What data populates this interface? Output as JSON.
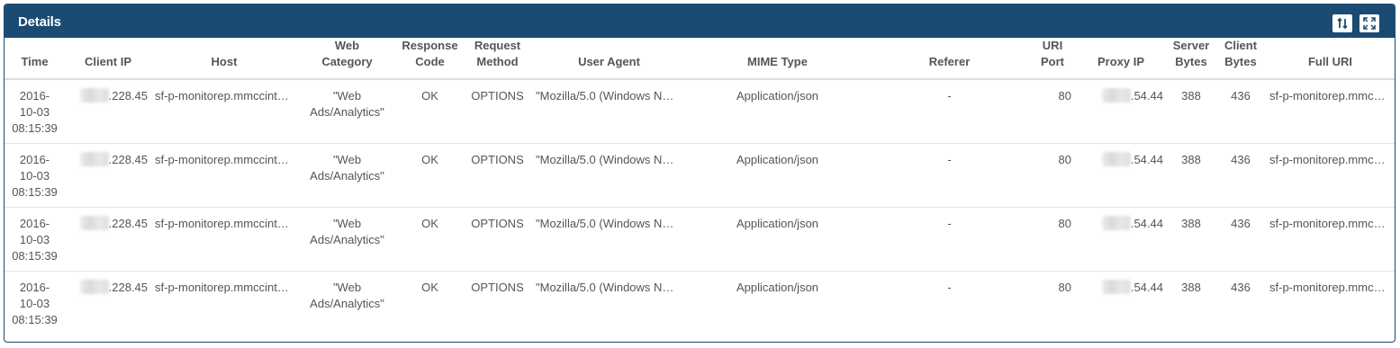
{
  "panel": {
    "title": "Details",
    "sort_icon": "sort-icon",
    "expand_icon": "expand-icon"
  },
  "columns": [
    [
      "Time"
    ],
    [
      "Client IP"
    ],
    [
      "Host"
    ],
    [
      "Web",
      "Category"
    ],
    [
      "Response",
      "Code"
    ],
    [
      "Request",
      "Method"
    ],
    [
      "User Agent"
    ],
    [
      "MIME Type"
    ],
    [
      "Referer"
    ],
    [
      "URI",
      "Port"
    ],
    [
      "Proxy IP"
    ],
    [
      "Server",
      "Bytes"
    ],
    [
      "Client",
      "Bytes"
    ],
    [
      "Full URI"
    ]
  ],
  "rows": [
    {
      "time": [
        "2016-",
        "10-03",
        "08:15:39"
      ],
      "client_ip": ".228.45",
      "host": "sf-p-monitorep.mmccint…",
      "web_category": [
        "\"Web",
        "Ads/Analytics\""
      ],
      "response_code": "OK",
      "request_method": "OPTIONS",
      "user_agent": "\"Mozilla/5.0 (Windows N…",
      "mime_type": "Application/json",
      "referer": "-",
      "uri_port": "80",
      "proxy_ip": ".54.44",
      "server_bytes": "388",
      "client_bytes": "436",
      "full_uri": "sf-p-monitorep.mmccint…"
    },
    {
      "time": [
        "2016-",
        "10-03",
        "08:15:39"
      ],
      "client_ip": ".228.45",
      "host": "sf-p-monitorep.mmccint…",
      "web_category": [
        "\"Web",
        "Ads/Analytics\""
      ],
      "response_code": "OK",
      "request_method": "OPTIONS",
      "user_agent": "\"Mozilla/5.0 (Windows N…",
      "mime_type": "Application/json",
      "referer": "-",
      "uri_port": "80",
      "proxy_ip": ".54.44",
      "server_bytes": "388",
      "client_bytes": "436",
      "full_uri": "sf-p-monitorep.mmccint…"
    },
    {
      "time": [
        "2016-",
        "10-03",
        "08:15:39"
      ],
      "client_ip": ".228.45",
      "host": "sf-p-monitorep.mmccint…",
      "web_category": [
        "\"Web",
        "Ads/Analytics\""
      ],
      "response_code": "OK",
      "request_method": "OPTIONS",
      "user_agent": "\"Mozilla/5.0 (Windows N…",
      "mime_type": "Application/json",
      "referer": "-",
      "uri_port": "80",
      "proxy_ip": ".54.44",
      "server_bytes": "388",
      "client_bytes": "436",
      "full_uri": "sf-p-monitorep.mmccint…"
    },
    {
      "time": [
        "2016-",
        "10-03",
        "08:15:39"
      ],
      "client_ip": ".228.45",
      "host": "sf-p-monitorep.mmccint…",
      "web_category": [
        "\"Web",
        "Ads/Analytics\""
      ],
      "response_code": "OK",
      "request_method": "OPTIONS",
      "user_agent": "\"Mozilla/5.0 (Windows N…",
      "mime_type": "Application/json",
      "referer": "-",
      "uri_port": "80",
      "proxy_ip": ".54.44",
      "server_bytes": "388",
      "client_bytes": "436",
      "full_uri": "sf-p-monitorep.mmccint…"
    }
  ]
}
